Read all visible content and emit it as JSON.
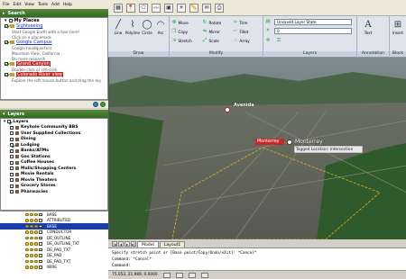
{
  "google_earth": {
    "menu": [
      "File",
      "Edit",
      "View",
      "Tools",
      "Add",
      "Help"
    ],
    "search_title": "Search",
    "places": {
      "title": "My Places",
      "items": [
        {
          "label": "Sightseeing",
          "sub": "Start Google Earth with a tour here!"
        },
        {
          "label": "Click on a placemark",
          "sub": ""
        },
        {
          "label": "Google Campus",
          "sub": "Google headquarters"
        },
        {
          "label": "Mountain View, California",
          "sub": "Do more research"
        },
        {
          "label": "Grand Canyon",
          "sub": "Double-click or ctrl-click"
        },
        {
          "label": "Colorado River view",
          "sub": "Explore the left mouse button and drag the sky"
        }
      ]
    },
    "layers_title": "Layers",
    "layers_root": "Layers",
    "layers": [
      "Keyhole Community BBS",
      "User Supplied Collections",
      "Dining",
      "Lodging",
      "Banks/ATMs",
      "Gas Stations",
      "Coffee Houses",
      "Malls/Shopping Centers",
      "Movie Rentals",
      "Movie Theaters",
      "Grocery Stores",
      "Pharmacies"
    ],
    "toolbar_icons": [
      "sidebar-icon",
      "placemark-icon",
      "polygon-icon",
      "path-icon",
      "overlay-icon",
      "sun-icon",
      "ruler-icon",
      "email-icon",
      "print-icon"
    ]
  },
  "cad_layers": [
    {
      "name": "BASE",
      "selected": false
    },
    {
      "name": "ATTRIBUTED",
      "selected": false
    },
    {
      "name": "BASE",
      "selected": true
    },
    {
      "name": "CONDUCTOR",
      "selected": false
    },
    {
      "name": "DE_OUTLINE",
      "selected": false
    },
    {
      "name": "DE_OUTLINE_TXT",
      "selected": false
    },
    {
      "name": "DE_PAD_TXT",
      "selected": false
    },
    {
      "name": "DE_PAD",
      "selected": false
    },
    {
      "name": "DE_PAD_TXT",
      "selected": false
    },
    {
      "name": "WIRE",
      "selected": false
    }
  ],
  "ribbon": {
    "draw": {
      "name": "Draw",
      "buttons": [
        "Line",
        "Polyline",
        "Circle",
        "Arc"
      ]
    },
    "modify": {
      "name": "Modify",
      "buttons": [
        "Move",
        "Rotate",
        "Trim",
        "Copy",
        "Mirror",
        "Fillet",
        "Stretch",
        "Scale",
        "Array"
      ]
    },
    "layers": {
      "name": "Layers",
      "state": "Unsaved Layer State",
      "current": "0"
    },
    "annotation": {
      "name": "Annotation",
      "button": "Text"
    },
    "block": {
      "name": "Block",
      "button": "Insert"
    }
  },
  "map_labels": {
    "placemark": "Avenida",
    "highlighted": "Monterrey",
    "city": "Monterrey",
    "tooltip": "Tagged Location: Intersection"
  },
  "tabs": [
    "Model",
    "Layout1"
  ],
  "command": {
    "line1": "Specify stretch point or [Base point/Copy/Undo/eXit]: *Cancel*",
    "line2": "Command: *Cancel*",
    "line3": "Command:"
  },
  "status": {
    "coords": "75.053, 21.989, 0.0000"
  },
  "colors": {
    "pane_green": "#2f6a1f",
    "selection": "#1b3fa8",
    "highlight_red": "#c62828",
    "parcel_line": "#e0b020"
  }
}
